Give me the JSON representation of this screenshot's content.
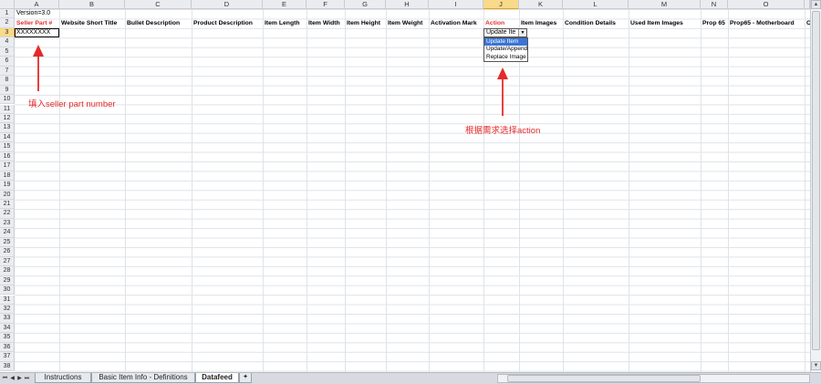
{
  "columns": [
    "A",
    "B",
    "C",
    "D",
    "E",
    "F",
    "G",
    "H",
    "I",
    "J",
    "K",
    "L",
    "M",
    "N",
    "O"
  ],
  "active_column": "J",
  "rows": [
    "1",
    "2",
    "3",
    "4",
    "5",
    "6",
    "7",
    "8",
    "9",
    "10",
    "11",
    "12",
    "13",
    "14",
    "15",
    "16",
    "17",
    "18",
    "19",
    "20",
    "21",
    "22",
    "23",
    "24",
    "25",
    "26",
    "27",
    "28",
    "29",
    "30",
    "31",
    "32",
    "33",
    "34",
    "35",
    "36",
    "37",
    "38"
  ],
  "active_row": "3",
  "cells": {
    "a1": "Version=3.0",
    "a3": "XXXXXXXX"
  },
  "headers": {
    "a": "Seller Part #",
    "b": "Website Short Title",
    "c": "Bullet Description",
    "d": "Product Description",
    "e": "Item Length",
    "f": "Item Width",
    "g": "Item Height",
    "h": "Item Weight",
    "i": "Activation Mark",
    "j": "Action",
    "k": "Item Images",
    "l": "Condition Details",
    "m": "Used Item Images",
    "n": "Prop 65",
    "o": "Prop65 - Motherboard",
    "p": "Co"
  },
  "dropdown": {
    "current": "Update Ite",
    "options": [
      "Update Item",
      "Update/Append",
      "Replace Image"
    ],
    "selected_index": 0
  },
  "annotations": {
    "seller_note": "填入seller part number",
    "action_note": "根据需求选择action"
  },
  "sheet_tabs": [
    "Instructions",
    "Basic Item Info - Definitions",
    "Datafeed"
  ],
  "active_tab": "Datafeed",
  "colors": {
    "annotation": "#e42a2a",
    "header_red": "#e03030",
    "selected_tab": "#ffffff",
    "active_header": "#f9d98a",
    "dropdown_highlight": "#3875d7"
  }
}
